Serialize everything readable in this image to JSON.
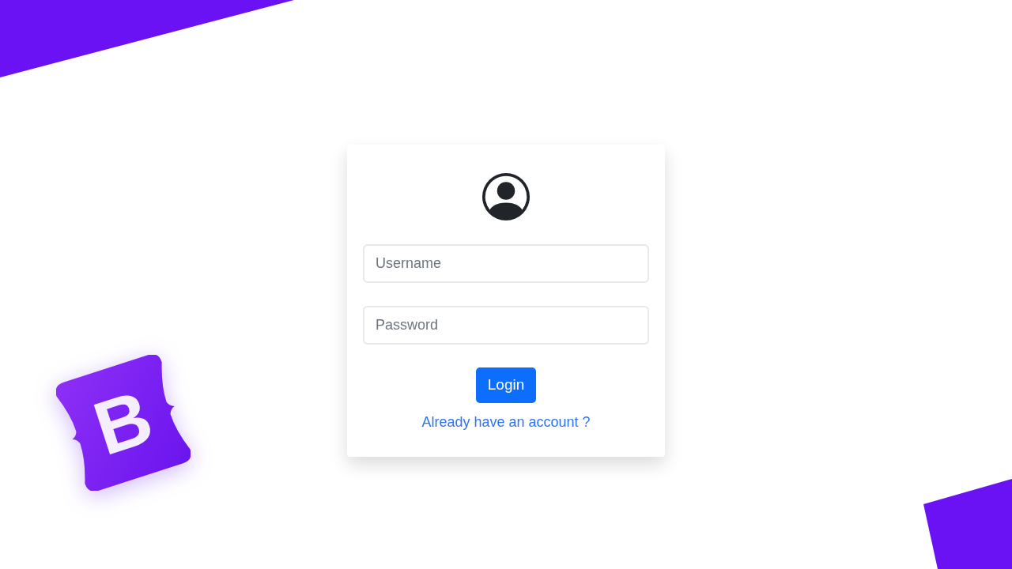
{
  "logo": {
    "text": "B"
  },
  "login_form": {
    "fields": [
      {
        "placeholder": "Username"
      },
      {
        "placeholder": "Password"
      }
    ],
    "submit_button": "Login",
    "account_link": "Already have an account ?"
  }
}
